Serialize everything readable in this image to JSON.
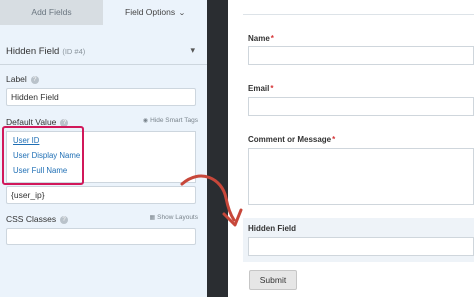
{
  "tabs": {
    "add_fields": "Add Fields",
    "field_options": "Field Options",
    "chevron_icon": "chevron-down"
  },
  "field": {
    "title": "Hidden Field",
    "id_label": "(ID #4)"
  },
  "label_field": {
    "label": "Label",
    "value": "Hidden Field"
  },
  "default_value": {
    "label": "Default Value",
    "toggle_smart_tags": "Hide Smart Tags",
    "smart_tags": [
      "User ID",
      "User Display Name",
      "User Full Name"
    ],
    "value": "{user_ip}"
  },
  "css_classes": {
    "label": "CSS Classes",
    "show_layouts": "Show Layouts",
    "value": ""
  },
  "form": {
    "fields": [
      {
        "label": "Name",
        "required": "*"
      },
      {
        "label": "Email",
        "required": "*"
      },
      {
        "label": "Comment or Message",
        "required": "*"
      },
      {
        "label": "Hidden Field",
        "required": ""
      }
    ],
    "submit_label": "Submit"
  },
  "colors": {
    "highlight": "#d1185a",
    "arrow": "#c7473a",
    "link": "#1f6fb5",
    "panel_bg": "#ebf3fb"
  }
}
